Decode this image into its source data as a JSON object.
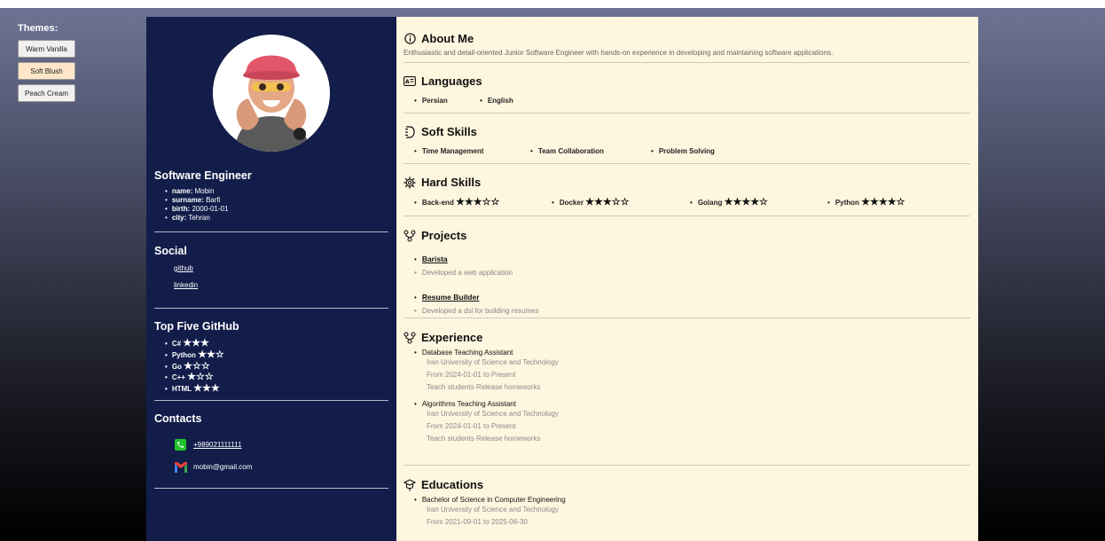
{
  "themes": {
    "title": "Themes:",
    "buttons": [
      "Warm Vanilla",
      "Soft Blush",
      "Peach Cream"
    ],
    "active_index": 1
  },
  "profile": {
    "role": "Software Engineer",
    "fields": [
      {
        "key": "name:",
        "value": "Mobin"
      },
      {
        "key": "surname:",
        "value": "Barfi"
      },
      {
        "key": "birth:",
        "value": "2000-01-01"
      },
      {
        "key": "city:",
        "value": "Tehran"
      }
    ]
  },
  "social": {
    "title": "Social",
    "links": [
      "github",
      "linkedin"
    ]
  },
  "github": {
    "title": "Top Five GitHub",
    "items": [
      {
        "label": "C#",
        "stars": "★★★"
      },
      {
        "label": "Python",
        "stars": "★★☆"
      },
      {
        "label": "Go",
        "stars": "★☆☆"
      },
      {
        "label": "C++",
        "stars": "★☆☆"
      },
      {
        "label": "HTML",
        "stars": "★★★"
      }
    ]
  },
  "contacts": {
    "title": "Contacts",
    "phone": "+989021111111",
    "email": "mobin@gmail.com"
  },
  "about": {
    "title": "About Me",
    "text": "Enthusiastic and detail-oriented Junior Software Engineer with hands-on experience in developing and maintaining software applications."
  },
  "languages": {
    "title": "Languages",
    "items": [
      "Persian",
      "English"
    ]
  },
  "soft_skills": {
    "title": "Soft Skills",
    "items": [
      "Time Management",
      "Team Collaboration",
      "Problem Solving"
    ]
  },
  "hard_skills": {
    "title": "Hard Skills",
    "items": [
      {
        "label": "Back-end",
        "stars": "★★★☆☆"
      },
      {
        "label": "Docker",
        "stars": "★★★☆☆"
      },
      {
        "label": "Golang",
        "stars": "★★★★☆"
      },
      {
        "label": "Python",
        "stars": "★★★★☆"
      }
    ]
  },
  "projects": {
    "title": "Projects",
    "items": [
      {
        "name": "Barista",
        "desc": "Developed a web application"
      },
      {
        "name": "Resume Builder",
        "desc": "Developed a dsl for building resumes"
      }
    ]
  },
  "experience": {
    "title": "Experience",
    "items": [
      {
        "role": "Database Teaching Assistant",
        "org": "Iran University of Science and Technology",
        "period": "From 2024-01-01 to Present",
        "desc": "Teach students Release homeworks"
      },
      {
        "role": "Algorithms Teaching Assistant",
        "org": "Iran University of Science and Technology",
        "period": "From 2024-01-01 to Present",
        "desc": "Teach students Release homeworks"
      }
    ]
  },
  "education": {
    "title": "Educations",
    "items": [
      {
        "degree": "Bachelor of Science in Computer Engineering",
        "org": "Iran University of Science and Technology",
        "period": "From 2021-09-01 to 2025-06-30"
      }
    ]
  },
  "colors": {
    "sidebar_bg": "#121d4a",
    "main_bg": "#fff6df",
    "active_theme": "#ffe6c8",
    "phone_green": "#1fc42a"
  }
}
